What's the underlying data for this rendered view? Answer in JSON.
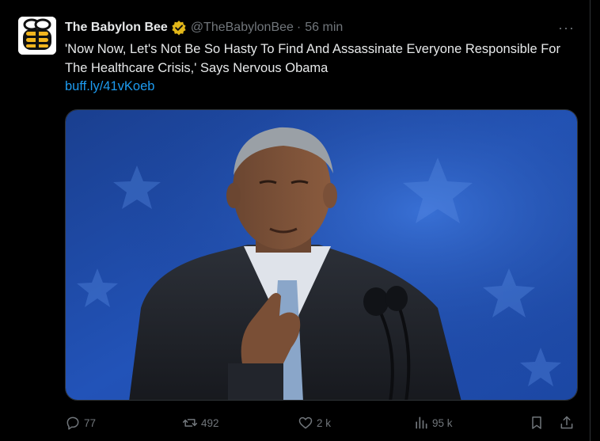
{
  "post": {
    "author_name": "The Babylon Bee",
    "handle": "@TheBabylonBee",
    "separator": "·",
    "time": "56 min",
    "more_label": "···",
    "headline": "'Now Now, Let's Not Be So Hasty To Find And Assassinate Everyone Responsible For The Healthcare Crisis,' Says Nervous Obama",
    "link": "buff.ly/41vKoeb"
  },
  "actions": {
    "replies": "77",
    "reposts": "492",
    "likes": "2 k",
    "views": "95 k"
  },
  "icons": {
    "verified": "verified-badge-icon",
    "reply": "reply-icon",
    "repost": "repost-icon",
    "like": "heart-icon",
    "views": "views-icon",
    "bookmark": "bookmark-icon",
    "share": "share-icon"
  },
  "colors": {
    "background": "#000000",
    "text": "#e7e9ea",
    "muted": "#71767b",
    "link": "#1d9bf0",
    "verified_gold": "#e2b719"
  }
}
